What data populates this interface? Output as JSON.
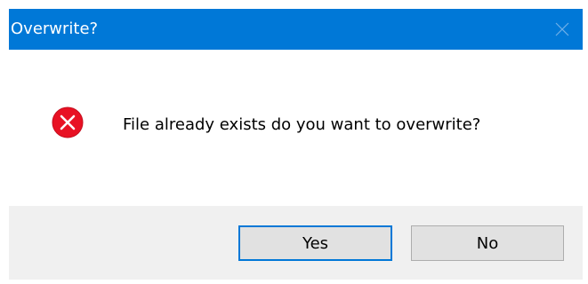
{
  "window": {
    "title": "Overwrite?",
    "accent_color": "#0078d7"
  },
  "message": {
    "icon": "error-icon",
    "text": "File already exists do you want to overwrite?"
  },
  "buttons": {
    "yes_label": "Yes",
    "no_label": "No",
    "default": "Yes"
  }
}
